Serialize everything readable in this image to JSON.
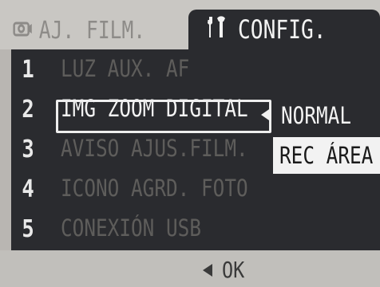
{
  "tabs": [
    {
      "label": "AJ. FILM.",
      "icon": "film-settings-icon",
      "state": "inactive"
    },
    {
      "label": "CONFIG.",
      "icon": "wrench-screwdriver-icon",
      "state": "active"
    }
  ],
  "menu": {
    "items": [
      {
        "number": "1",
        "label": "LUZ AUX. AF",
        "enabled": false
      },
      {
        "number": "2",
        "label": "IMG ZOOM DIGITAL",
        "enabled": true,
        "selected": true
      },
      {
        "number": "3",
        "label": "AVISO AJUS.FILM.",
        "enabled": false
      },
      {
        "number": "4",
        "label": "ICONO AGRD. FOTO",
        "enabled": false
      },
      {
        "number": "5",
        "label": "CONEXIÓN USB",
        "enabled": false
      }
    ]
  },
  "popup": {
    "options": [
      {
        "label": "NORMAL",
        "highlighted": false
      },
      {
        "label": "REC ÁREA",
        "highlighted": true
      }
    ]
  },
  "footer": {
    "hint": "OK",
    "icon": "left-arrow-icon"
  },
  "colors": {
    "panel": "#2a2b2f",
    "tab_strip": "#c9c7c3",
    "footer": "#c1bfbb",
    "highlight_bg": "#f2f2f2",
    "active_text": "#f3f3f3",
    "disabled_text": "#5e5d5b"
  }
}
